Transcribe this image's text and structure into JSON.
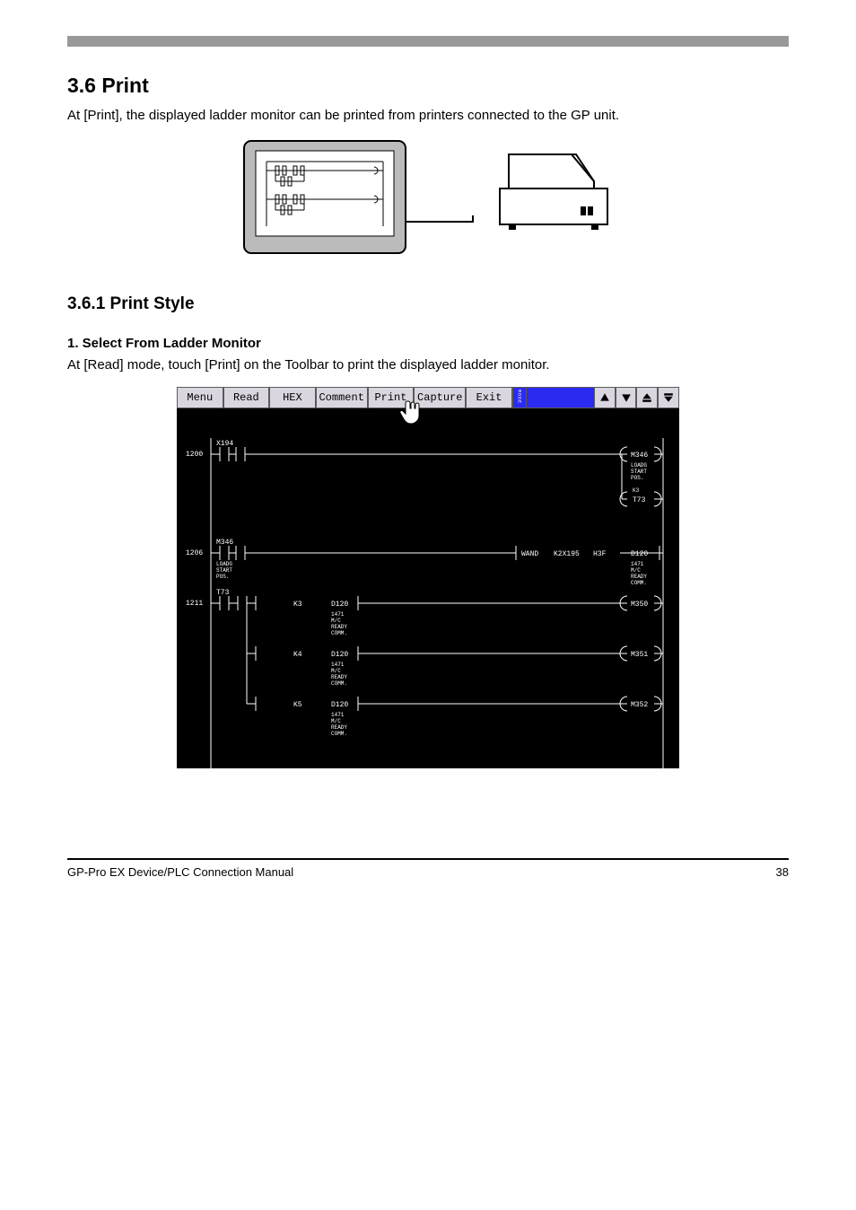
{
  "section": {
    "number": "3.6",
    "title": "Print",
    "intro": "At [Print], the displayed ladder monitor can be printed from printers connected to the GP unit.",
    "style_title": "3.6.1 Print Style",
    "item_title": "1. Select From Ladder Monitor",
    "item_body": "At [Read] mode, touch [Print] on the Toolbar to print the displayed ladder monitor."
  },
  "chart_data": {
    "toolbar": {
      "buttons": [
        "Menu",
        "Read",
        "HEX",
        "Comment",
        "Print",
        "Capture",
        "Exit"
      ],
      "mode_badge": "MODE",
      "nav": [
        "up",
        "down",
        "page-up",
        "page-down"
      ]
    },
    "rungs": [
      {
        "step": 1200,
        "contacts": [
          {
            "x": 1,
            "type": "NO",
            "label_top": "X194"
          }
        ],
        "outputs": [
          {
            "type": "coil",
            "label_right": "M346",
            "sub_top": "LOADG",
            "sub_mid": "START",
            "sub_bot": "POS."
          },
          {
            "type": "coil",
            "label_right": "T73",
            "sub_top": "K3"
          }
        ]
      },
      {
        "step": 1206,
        "contacts": [
          {
            "x": 1,
            "type": "NO",
            "label_top": "M346",
            "sub_top": "LOADG",
            "sub_mid": "START",
            "sub_bot": "POS."
          }
        ],
        "block": {
          "cmd": "WAND",
          "args": [
            "K2X195",
            "H3F"
          ]
        },
        "outputs": [
          {
            "type": "box",
            "label_right": "D120",
            "sub_top": "1471",
            "sub_mid": "M/C",
            "sub_bot": "READY",
            "sub_last": "COMM."
          }
        ]
      },
      {
        "step": 1211,
        "contacts": [
          {
            "x": 1,
            "type": "NO",
            "label_top": "T73"
          },
          {
            "x": 2,
            "type": "CMP",
            "k": "K3",
            "dev": "D120",
            "sub_top": "1471",
            "sub_mid": "M/C",
            "sub_bot": "READY",
            "sub_last": "COMM."
          }
        ],
        "outputs": [
          {
            "type": "coil",
            "label_right": "M350"
          }
        ],
        "branches": [
          {
            "contacts": [
              {
                "x": 2,
                "type": "CMP",
                "k": "K4",
                "dev": "D120",
                "sub_top": "1471",
                "sub_mid": "M/C",
                "sub_bot": "READY",
                "sub_last": "COMM."
              }
            ],
            "outputs": [
              {
                "type": "coil",
                "label_right": "M351"
              }
            ]
          },
          {
            "contacts": [
              {
                "x": 2,
                "type": "CMP",
                "k": "K5",
                "dev": "D120",
                "sub_top": "1471",
                "sub_mid": "M/C",
                "sub_bot": "READY",
                "sub_last": "COMM."
              }
            ],
            "outputs": [
              {
                "type": "coil",
                "label_right": "M352"
              }
            ]
          }
        ]
      }
    ]
  },
  "footer": {
    "page_left": "GP-Pro EX Device/PLC Connection Manual",
    "page_right": "38"
  }
}
